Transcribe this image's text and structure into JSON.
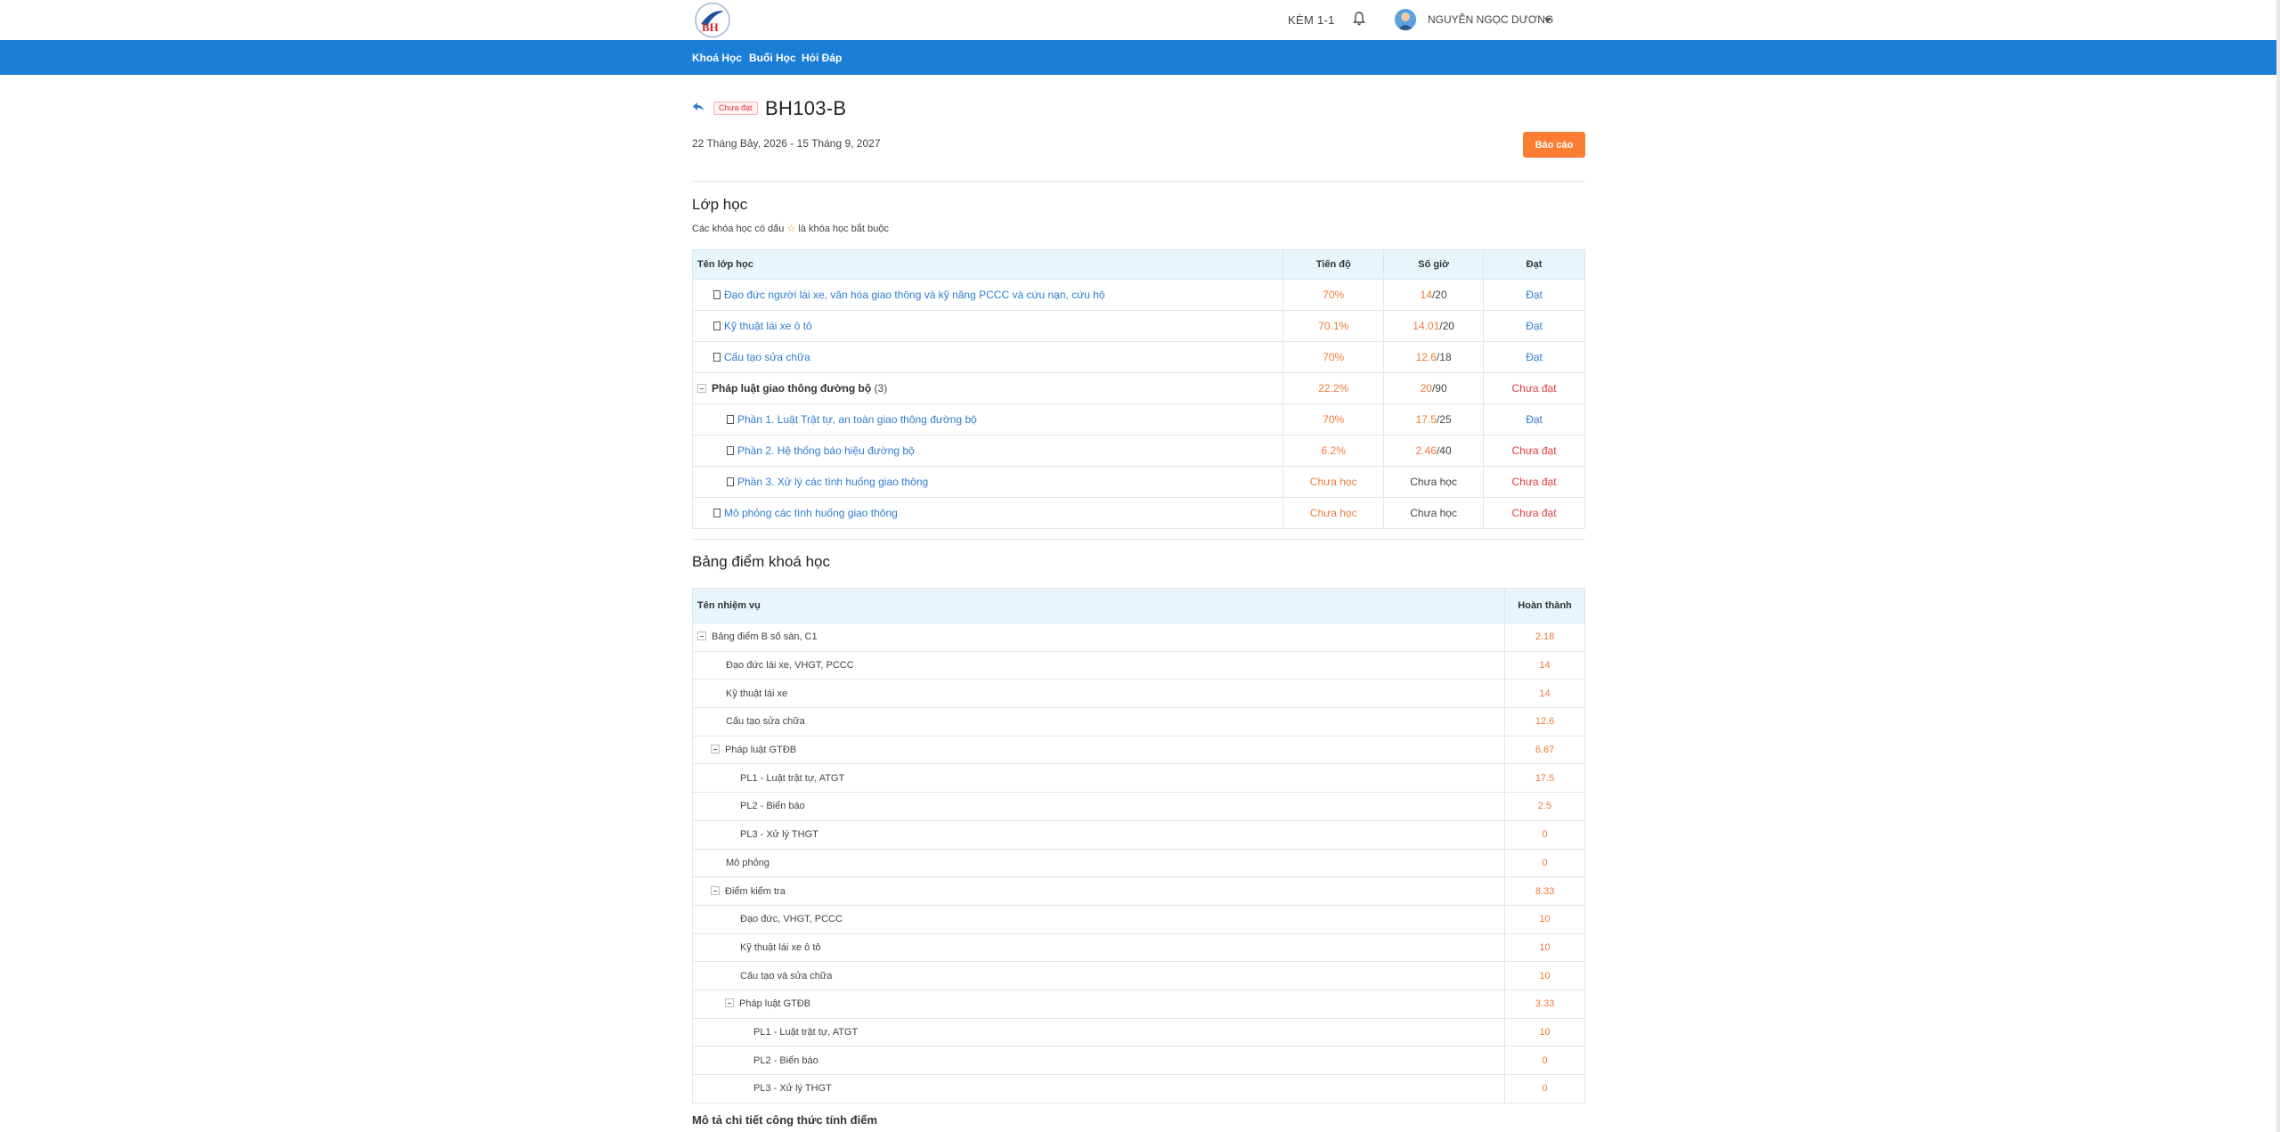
{
  "header": {
    "kem_label": "KÈM 1-1",
    "user_name": "NGUYỄN NGỌC DƯƠNG"
  },
  "nav": {
    "items": [
      "Khoá Học",
      "Buổi Học",
      "Hỏi Đáp"
    ]
  },
  "course": {
    "status": "Chưa đạt",
    "code": "BH103-B",
    "date_range": "22 Tháng Bảy, 2026 - 15 Tháng 9, 2027",
    "report_label": "Báo cáo"
  },
  "classes": {
    "title": "Lớp học",
    "note_before": "Các khóa học có dấu",
    "note_after": "là khóa học bắt buộc",
    "headers": [
      "Tên lớp học",
      "Tiến độ",
      "Số giờ",
      "Đạt"
    ],
    "rows": [
      {
        "name": "Đạo đức người lái xe, văn hóa giao thông và kỹ năng PCCC và cứu nạn, cứu hộ",
        "progress": "70%",
        "hours_done": "14",
        "hours_total": "/20",
        "result": "Đạt"
      },
      {
        "name": "Kỹ thuật lái xe ô tô",
        "progress": "70.1%",
        "hours_done": "14.01",
        "hours_total": "/20",
        "result": "Đạt"
      },
      {
        "name": "Cấu tạo sửa chữa",
        "progress": "70%",
        "hours_done": "12.6",
        "hours_total": "/18",
        "result": "Đạt"
      },
      {
        "name": "Pháp luật giao thông đường bộ",
        "count": "(3)",
        "progress": "22.2%",
        "hours_done": "20",
        "hours_total": "/90",
        "result": "Chưa đạt"
      },
      {
        "name": "Phần 1. Luật Trật tự, an toàn giao thông đường bộ",
        "progress": "70%",
        "hours_done": "17.5",
        "hours_total": "/25",
        "result": "Đạt"
      },
      {
        "name": "Phần 2. Hệ thống báo hiệu đường bộ",
        "progress": "6.2%",
        "hours_done": "2.46",
        "hours_total": "/40",
        "result": "Chưa đạt"
      },
      {
        "name": "Phần 3. Xử lý các tình huống giao thông",
        "progress": "Chưa học",
        "hours_text": "Chưa học",
        "result": "Chưa đạt"
      },
      {
        "name": "Mô phỏng các tình huống giao thông",
        "progress": "Chưa học",
        "hours_text": "Chưa học",
        "result": "Chưa đạt"
      }
    ]
  },
  "scores": {
    "title": "Bảng điểm khoá học",
    "headers": [
      "Tên nhiệm vụ",
      "Hoàn thành"
    ],
    "rows": [
      {
        "name": "Bảng điểm B số sàn, C1",
        "value": "2.18"
      },
      {
        "name": "Đạo đức lái xe, VHGT, PCCC",
        "value": "14"
      },
      {
        "name": "Kỹ thuật lái xe",
        "value": "14"
      },
      {
        "name": "Cấu tạo sửa chữa",
        "value": "12.6"
      },
      {
        "name": "Pháp luật GTĐB",
        "value": "6.67"
      },
      {
        "name": "PL1 - Luật trật tự, ATGT",
        "value": "17.5"
      },
      {
        "name": "PL2 - Biển báo",
        "value": "2.5"
      },
      {
        "name": "PL3 - Xử lý THGT",
        "value": "0"
      },
      {
        "name": "Mô phỏng",
        "value": "0"
      },
      {
        "name": "Điểm kiểm tra",
        "value": "8.33"
      },
      {
        "name": "Đạo đức, VHGT, PCCC",
        "value": "10"
      },
      {
        "name": "Kỹ thuật lái xe ô tô",
        "value": "10"
      },
      {
        "name": "Cấu tạo và sửa chữa",
        "value": "10"
      },
      {
        "name": "Pháp luật GTĐB",
        "value": "3.33"
      },
      {
        "name": "PL1 - Luật trật tự, ATGT",
        "value": "10"
      },
      {
        "name": "PL2 - Biển báo",
        "value": "0"
      },
      {
        "name": "PL3 - Xử lý THGT",
        "value": "0"
      }
    ]
  },
  "footer": {
    "formula_label": "Mô tả chi tiết công thức tính điểm"
  }
}
